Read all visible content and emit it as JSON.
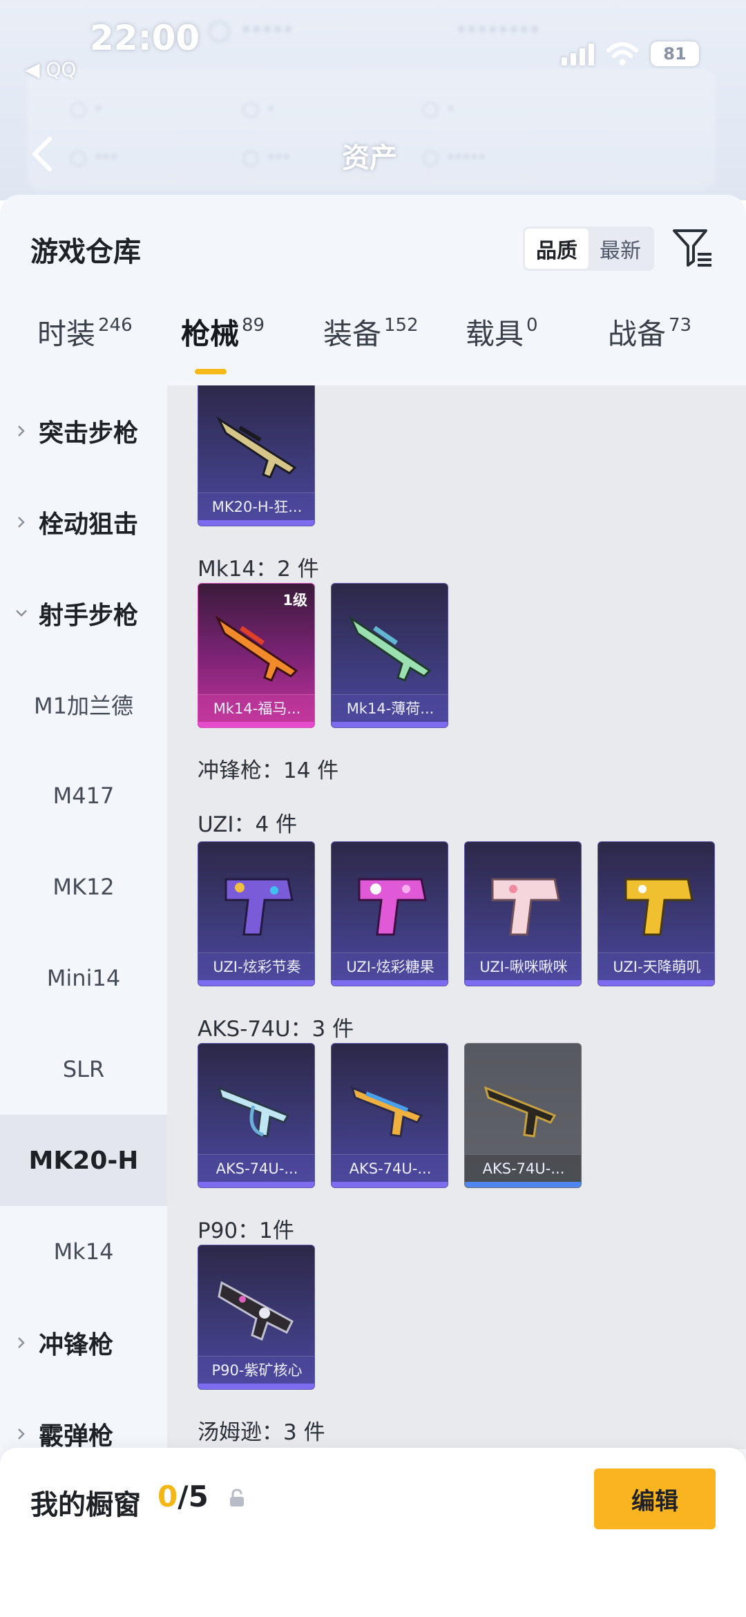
{
  "status_bar": {
    "time": "22:00",
    "back_app": "◀ QQ",
    "battery": "81"
  },
  "header": {
    "title": "资产"
  },
  "panel": {
    "title": "游戏仓库",
    "sort": {
      "quality": "品质",
      "latest": "最新"
    }
  },
  "tabs": [
    {
      "label": "时装",
      "count": "246"
    },
    {
      "label": "枪械",
      "count": "89"
    },
    {
      "label": "装备",
      "count": "152"
    },
    {
      "label": "载具",
      "count": "0"
    },
    {
      "label": "战备",
      "count": "73"
    }
  ],
  "sidebar": {
    "items": [
      {
        "label": "突击步枪",
        "type": "category"
      },
      {
        "label": "栓动狙击",
        "type": "category"
      },
      {
        "label": "射手步枪",
        "type": "category-open"
      },
      {
        "label": "M1加兰德",
        "type": "sub"
      },
      {
        "label": "M417",
        "type": "sub"
      },
      {
        "label": "MK12",
        "type": "sub"
      },
      {
        "label": "Mini14",
        "type": "sub"
      },
      {
        "label": "SLR",
        "type": "sub"
      },
      {
        "label": "MK20-H",
        "type": "sub-active"
      },
      {
        "label": "Mk14",
        "type": "sub"
      },
      {
        "label": "冲锋枪",
        "type": "category"
      },
      {
        "label": "霰弹枪",
        "type": "category"
      }
    ]
  },
  "content": {
    "groups": [
      {
        "label": "Mk14：2 件"
      },
      {
        "label": "冲锋枪：14 件"
      },
      {
        "label": "UZI：4 件"
      },
      {
        "label": "AKS-74U：3 件"
      },
      {
        "label": "P90：1件"
      },
      {
        "label": "汤姆逊：3 件"
      }
    ],
    "cards": [
      {
        "name": "MK20-H-狂...",
        "style": "purple"
      },
      {
        "name": "Mk14-福马...",
        "style": "pink",
        "level": "1级"
      },
      {
        "name": "Mk14-薄荷...",
        "style": "purple"
      },
      {
        "name": "UZI-炫彩节奏",
        "style": "purple"
      },
      {
        "name": "UZI-炫彩糖果",
        "style": "purple"
      },
      {
        "name": "UZI-啾咪啾咪",
        "style": "purple"
      },
      {
        "name": "UZI-天降萌叽",
        "style": "purple"
      },
      {
        "name": "AKS-74U-...",
        "style": "purple"
      },
      {
        "name": "AKS-74U-...",
        "style": "purple"
      },
      {
        "name": "AKS-74U-...",
        "style": "gray"
      },
      {
        "name": "P90-紫矿核心",
        "style": "purple"
      }
    ]
  },
  "showcase": {
    "title": "我的橱窗",
    "current": "0",
    "max": "/5",
    "edit": "编辑"
  },
  "colors": {
    "accent": "#f8b622",
    "tab_indicator": "#f6b91a",
    "card_purple": "#3d3a78",
    "card_pink": "#c4359c"
  },
  "icons": [
    "back-chevron-icon",
    "filter-icon",
    "chevron-right-icon",
    "chevron-down-icon",
    "share-external-icon",
    "lock-icon",
    "wifi-icon",
    "signal-icon"
  ]
}
